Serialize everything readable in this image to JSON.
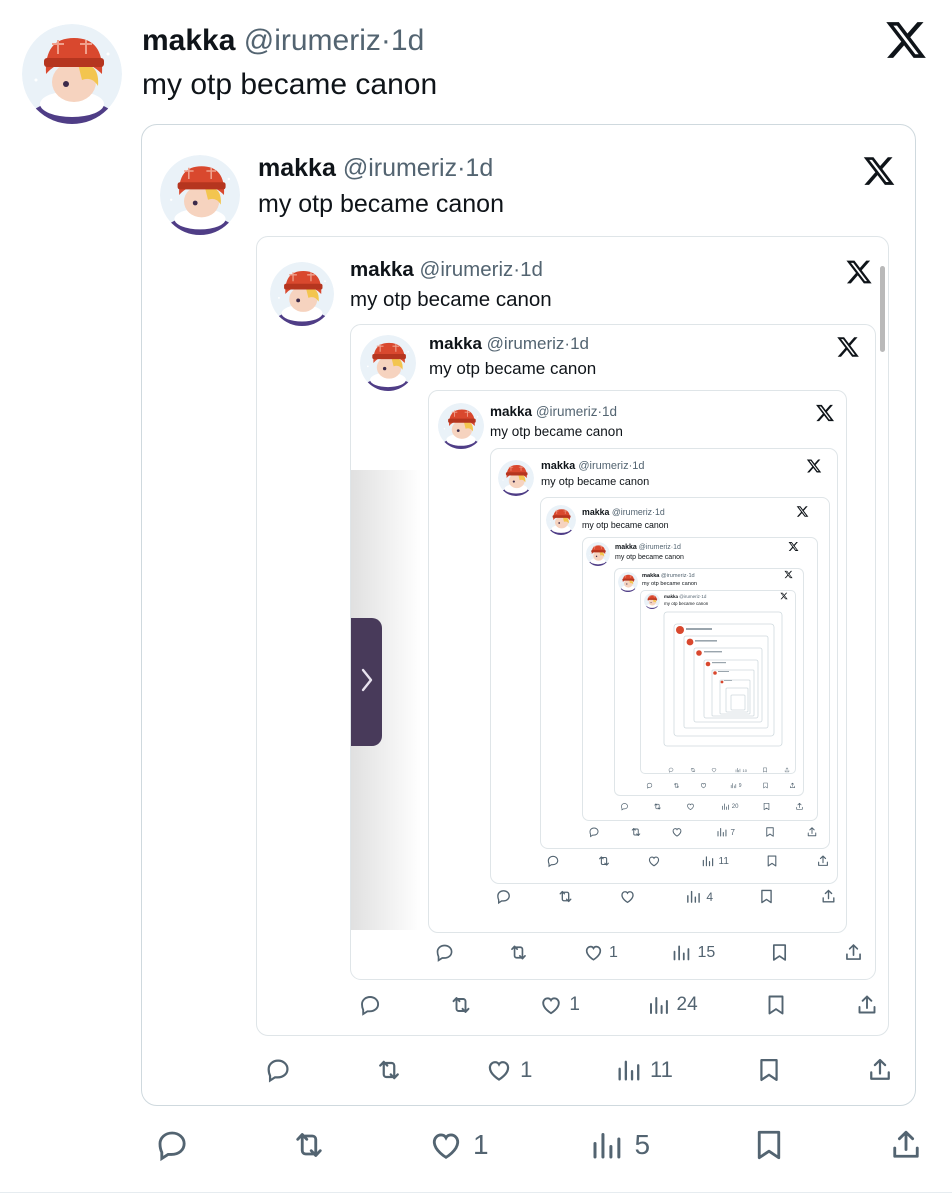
{
  "tweet": {
    "name": "makka",
    "handle": "@irumeriz",
    "dot": "·",
    "time": "1d",
    "text": "my otp became canon"
  },
  "levels": [
    {
      "likes": "1",
      "views": "5"
    },
    {
      "likes": "1",
      "views": "11"
    },
    {
      "likes": "1",
      "views": "24"
    },
    {
      "likes": "1",
      "views": "15"
    },
    {
      "likes": "",
      "views": "4"
    },
    {
      "likes": "",
      "views": "11"
    },
    {
      "likes": "",
      "views": "7"
    },
    {
      "likes": "",
      "views": "20"
    },
    {
      "likes": "",
      "views": "9"
    },
    {
      "likes": "",
      "views": "10"
    }
  ],
  "icons": {
    "x_logo": "x-logo-icon",
    "reply": "reply-icon",
    "retweet": "retweet-icon",
    "like": "heart-icon",
    "views": "views-chart-icon",
    "bookmark": "bookmark-icon",
    "share": "share-icon",
    "side_tab": "chevron-right-icon"
  },
  "colors": {
    "text": "#0f1419",
    "secondary": "#536471",
    "border": "#cfd9de",
    "side_tab": "#483a5a"
  }
}
